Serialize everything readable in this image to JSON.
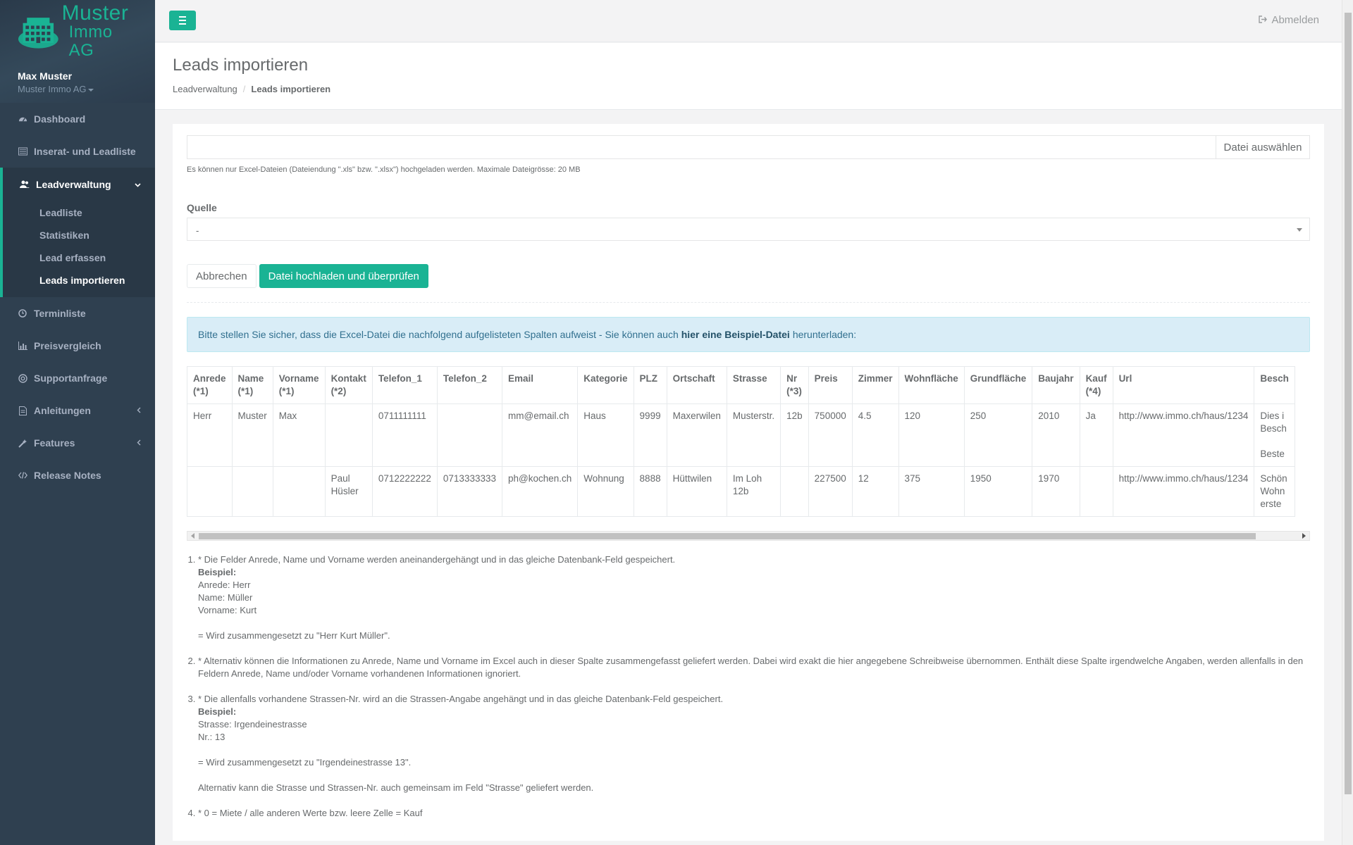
{
  "brand": {
    "line1": "Muster",
    "line2": "Immo AG",
    "color": "#1ab394"
  },
  "user": {
    "name": "Max Muster",
    "company": "Muster Immo AG"
  },
  "nav": [
    {
      "label": "Dashboard",
      "icon": "dashboard-icon"
    },
    {
      "label": "Inserat- und Leadliste",
      "icon": "list-icon"
    },
    {
      "label": "Leadverwaltung",
      "icon": "users-icon",
      "sub": [
        "Leadliste",
        "Statistiken",
        "Lead erfassen",
        "Leads importieren"
      ]
    },
    {
      "label": "Terminliste",
      "icon": "clock-icon"
    },
    {
      "label": "Preisvergleich",
      "icon": "bar-chart-icon"
    },
    {
      "label": "Supportanfrage",
      "icon": "globe-icon"
    },
    {
      "label": "Anleitungen",
      "icon": "file-icon"
    },
    {
      "label": "Features",
      "icon": "magic-icon"
    },
    {
      "label": "Release Notes",
      "icon": "code-icon"
    }
  ],
  "topbar": {
    "logout": "Abmelden"
  },
  "page": {
    "title": "Leads importieren",
    "breadcrumb": [
      "Leadverwaltung",
      "Leads importieren"
    ]
  },
  "upload": {
    "choose_button": "Datei auswählen",
    "hint": "Es können nur Excel-Dateien (Dateiendung \".xls\" bzw. \".xlsx\") hochgeladen werden. Maximale Dateigrösse: 20 MB",
    "source_label": "Quelle",
    "source_value": "-",
    "cancel": "Abbrechen",
    "submit": "Datei hochladen und überprüfen"
  },
  "alert": {
    "before": "Bitte stellen Sie sicher, dass die Excel-Datei die nachfolgend aufgelisteten Spalten aufweist - Sie können auch",
    "link": "hier eine Beispiel-Datei",
    "after": "herunterladen:"
  },
  "table": {
    "headers": [
      [
        "Anrede",
        "(*1)"
      ],
      [
        "Name",
        "(*1)"
      ],
      [
        "Vorname",
        "(*1)"
      ],
      [
        "Kontakt",
        "(*2)"
      ],
      [
        "Telefon_1"
      ],
      [
        "Telefon_2"
      ],
      [
        "Email"
      ],
      [
        "Kategorie"
      ],
      [
        "PLZ"
      ],
      [
        "Ortschaft"
      ],
      [
        "Strasse"
      ],
      [
        "Nr",
        "(*3)"
      ],
      [
        "Preis"
      ],
      [
        "Zimmer"
      ],
      [
        "Wohnfläche"
      ],
      [
        "Grundfläche"
      ],
      [
        "Baujahr"
      ],
      [
        "Kauf",
        "(*4)"
      ],
      [
        "Url"
      ],
      [
        "Besch"
      ]
    ],
    "rows": [
      [
        [
          "Herr"
        ],
        [
          "Muster"
        ],
        [
          "Max"
        ],
        [
          ""
        ],
        [
          "0711111111"
        ],
        [
          ""
        ],
        [
          "mm@email.ch"
        ],
        [
          "Haus"
        ],
        [
          "9999"
        ],
        [
          "Maxerwilen"
        ],
        [
          "Musterstr."
        ],
        [
          "12b"
        ],
        [
          "750000"
        ],
        [
          "4.5"
        ],
        [
          "120"
        ],
        [
          "250"
        ],
        [
          "2010"
        ],
        [
          "Ja"
        ],
        [
          "http://www.immo.ch/haus/1234"
        ],
        [
          "Dies i",
          "Besch",
          "",
          "Beste"
        ]
      ],
      [
        [
          ""
        ],
        [
          ""
        ],
        [
          ""
        ],
        [
          "Paul",
          "Hüsler"
        ],
        [
          "0712222222"
        ],
        [
          "0713333333"
        ],
        [
          "ph@kochen.ch"
        ],
        [
          "Wohnung"
        ],
        [
          "8888"
        ],
        [
          "Hüttwilen"
        ],
        [
          "Im Loh",
          "12b"
        ],
        [
          ""
        ],
        [
          "227500"
        ],
        [
          "12"
        ],
        [
          "375"
        ],
        [
          "1950"
        ],
        [
          "1970"
        ],
        [
          ""
        ],
        [
          "http://www.immo.ch/haus/1234"
        ],
        [
          "Schön",
          "Wohn",
          "erste"
        ]
      ]
    ]
  },
  "notes": [
    [
      "* Die Felder Anrede, Name und Vorname werden aneinandergehängt und in das gleiche Datenbank-Feld gespeichert.",
      "**Beispiel:",
      "Anrede: Herr",
      "Name: Müller",
      "Vorname: Kurt",
      "",
      "= Wird zusammengesetzt zu \"Herr Kurt Müller\"."
    ],
    [
      "* Alternativ können die Informationen zu Anrede, Name und Vorname im Excel auch in dieser Spalte zusammengefasst geliefert werden. Dabei wird exakt die hier angegebene Schreibweise übernommen. Enthält diese Spalte irgendwelche Angaben, werden allenfalls in den Feldern Anrede, Name und/oder Vorname vorhandenen Informationen ignoriert."
    ],
    [
      "* Die allenfalls vorhandene Strassen-Nr. wird an die Strassen-Angabe angehängt und in das gleiche Datenbank-Feld gespeichert.",
      "**Beispiel:",
      "Strasse: Irgendeinestrasse",
      "Nr.: 13",
      "",
      "= Wird zusammengesetzt zu \"Irgendeinestrasse 13\".",
      "",
      "Alternativ kann die Strasse und Strassen-Nr. auch gemeinsam im Feld \"Strasse\" geliefert werden."
    ],
    [
      "* 0 = Miete / alle anderen Werte bzw. leere Zelle = Kauf"
    ]
  ]
}
